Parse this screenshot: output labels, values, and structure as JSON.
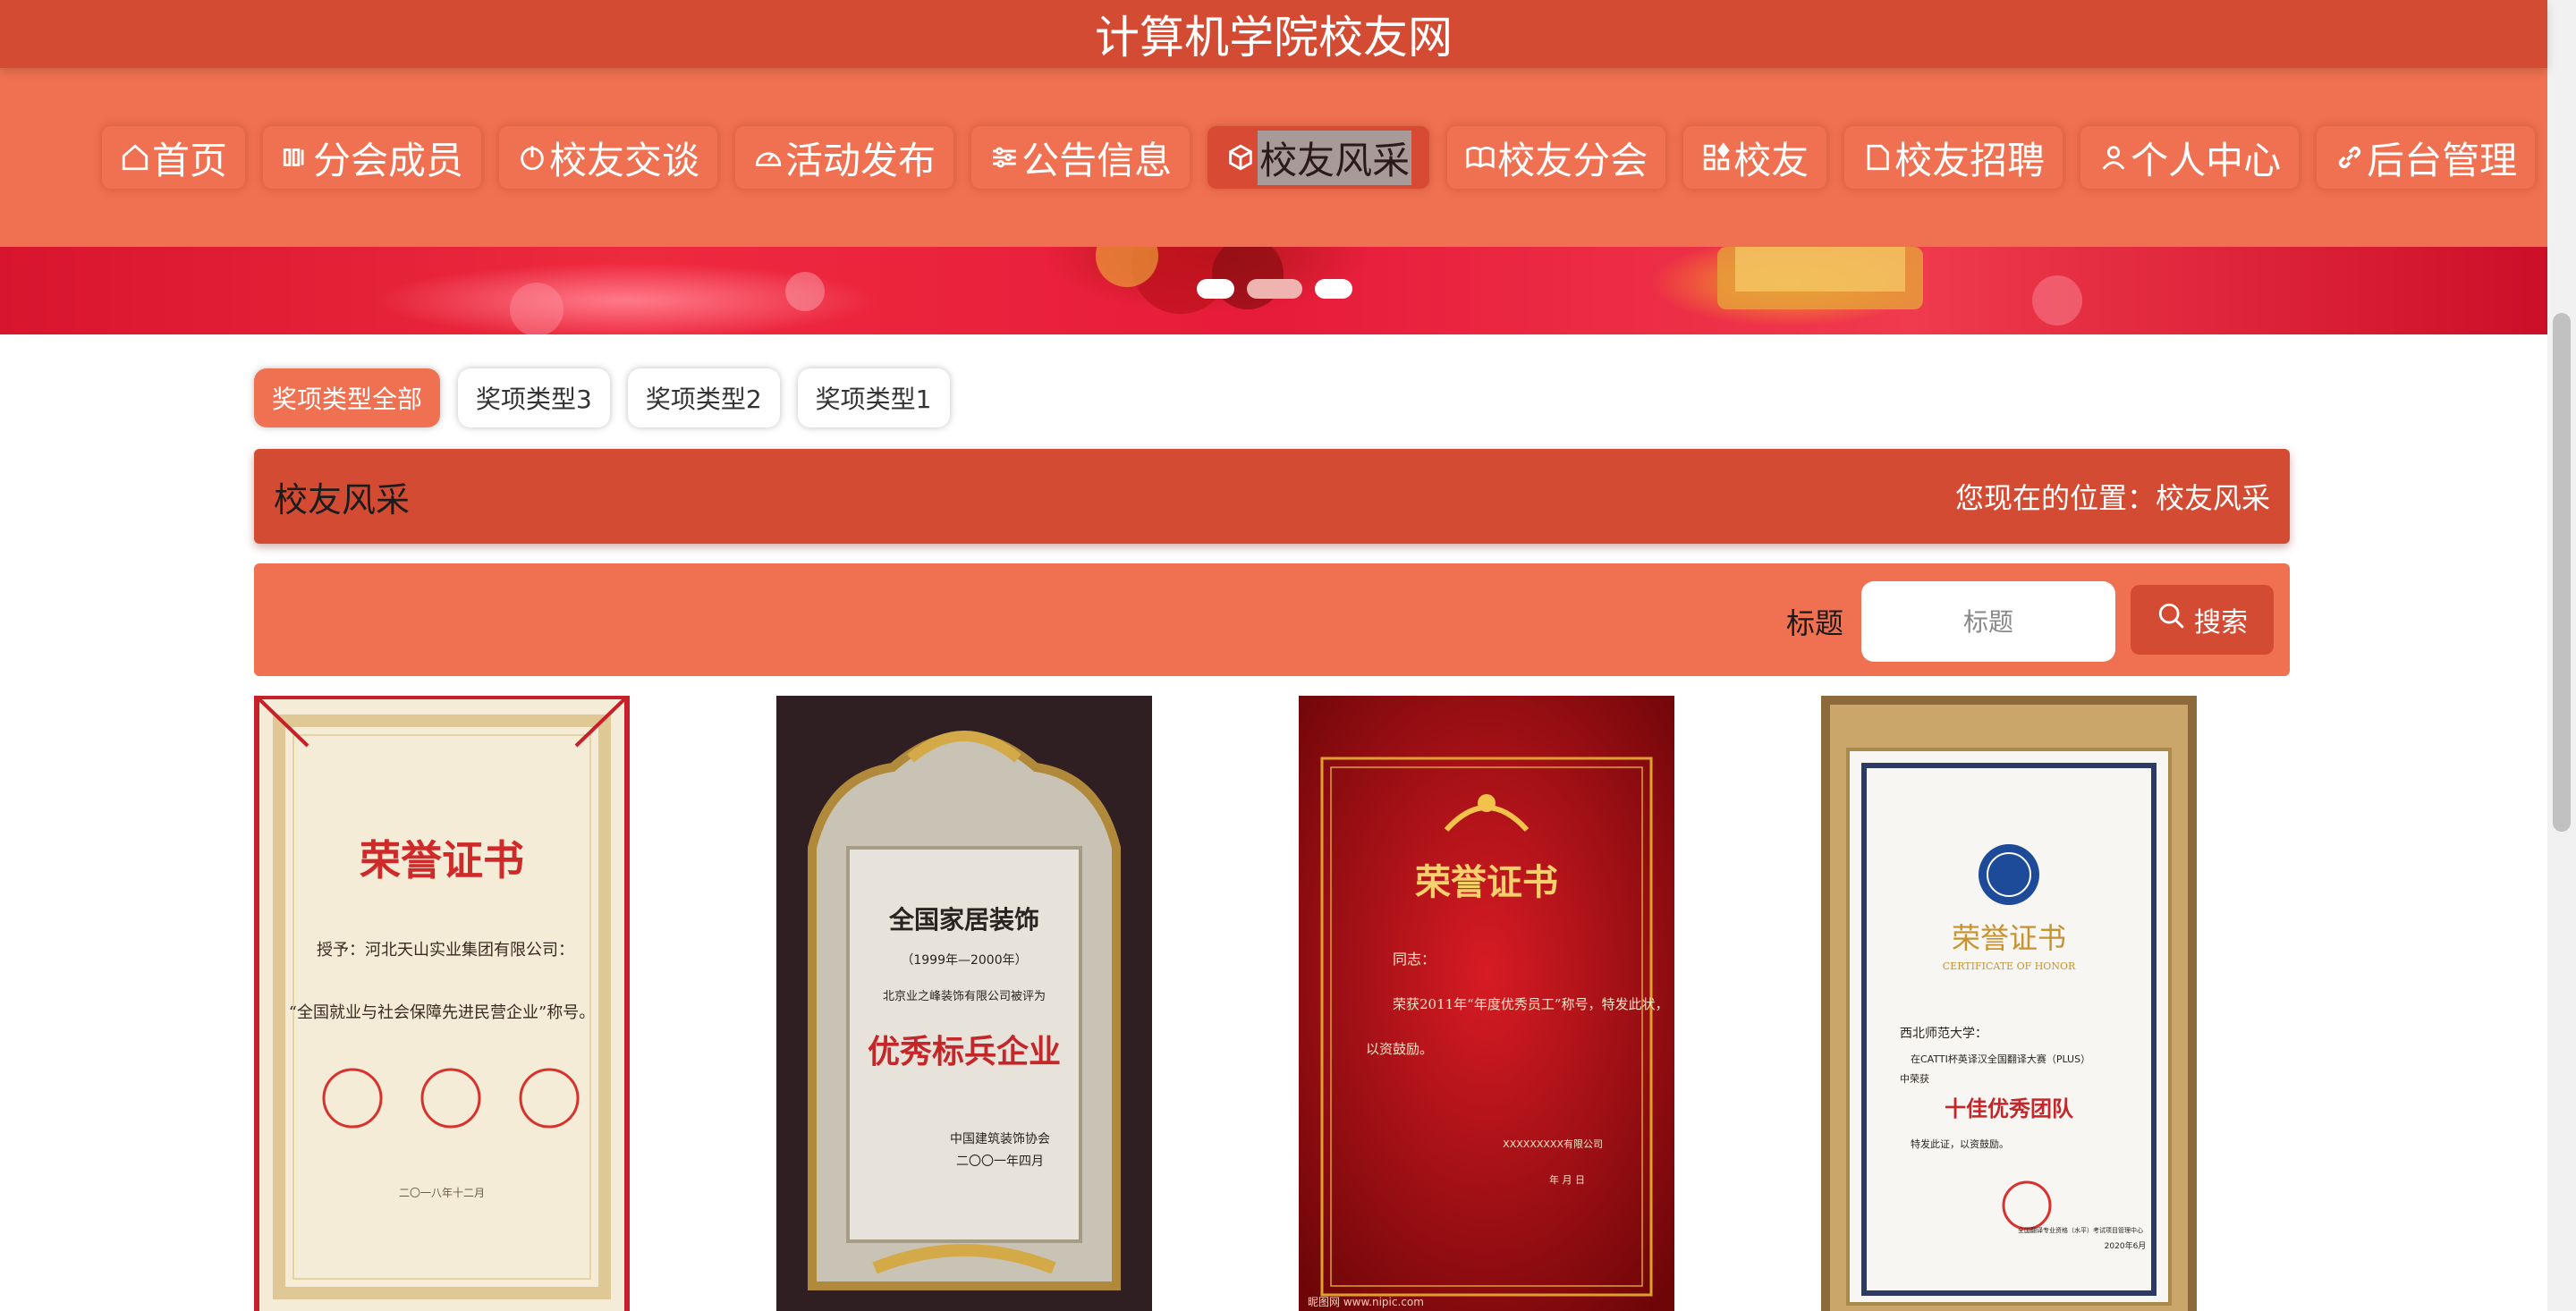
{
  "site": {
    "title": "计算机学院校友网"
  },
  "nav": [
    {
      "label": "首页",
      "icon": "home-icon"
    },
    {
      "label": "分会成员",
      "icon": "members-icon"
    },
    {
      "label": "校友交谈",
      "icon": "power-icon"
    },
    {
      "label": "活动发布",
      "icon": "gauge-icon"
    },
    {
      "label": "公告信息",
      "icon": "sliders-icon"
    },
    {
      "label": "校友风采",
      "icon": "cube-icon",
      "active": true
    },
    {
      "label": "校友分会",
      "icon": "book-icon"
    },
    {
      "label": "校友",
      "icon": "grid-icon"
    },
    {
      "label": "校友招聘",
      "icon": "document-icon"
    },
    {
      "label": "个人中心",
      "icon": "user-icon"
    },
    {
      "label": "后台管理",
      "icon": "link-icon"
    }
  ],
  "banner": {
    "dots": 3,
    "active_dot": 2
  },
  "filters": [
    {
      "label": "奖项类型全部",
      "active": true
    },
    {
      "label": "奖项类型3"
    },
    {
      "label": "奖项类型2"
    },
    {
      "label": "奖项类型1"
    }
  ],
  "page": {
    "title": "校友风采",
    "breadcrumb": "您现在的位置：校友风采"
  },
  "search": {
    "label": "标题",
    "placeholder": "标题",
    "button": "搜索",
    "button_icon": "search-icon"
  },
  "certificates": [
    {
      "heading": "荣誉证书",
      "recipient": "授予：河北天山实业集团有限公司：",
      "body": "“全国就业与社会保障先进民营企业”称号。",
      "date": "二〇一八年十二月"
    },
    {
      "heading": "全国家居装饰",
      "period": "（1999年—2000年）",
      "body": "北京业之峰装饰有限公司被评为",
      "award": "优秀标兵企业",
      "issuer": "中国建筑装饰协会",
      "date": "二〇〇一年四月"
    },
    {
      "heading": "荣誉证书",
      "recipient": "同志：",
      "body": "荣获2011年“年度优秀员工”称号，特发此状，",
      "body2": "以资鼓励。",
      "issuer": "XXXXXXXXX有限公司",
      "date": "年 月 日",
      "footer": "昵图网 www.nipic.com"
    },
    {
      "heading": "荣誉证书",
      "subheading": "CERTIFICATE OF HONOR",
      "recipient": "西北师范大学：",
      "body": "在CATTI杯英译汉全国翻译大赛（PLUS）",
      "body2": "中荣获",
      "award": "十佳优秀团队",
      "note": "特发此证，以资鼓励。",
      "issuer": "全国翻译专业资格（水平）考试项目管理中心",
      "date": "2020年6月"
    }
  ]
}
